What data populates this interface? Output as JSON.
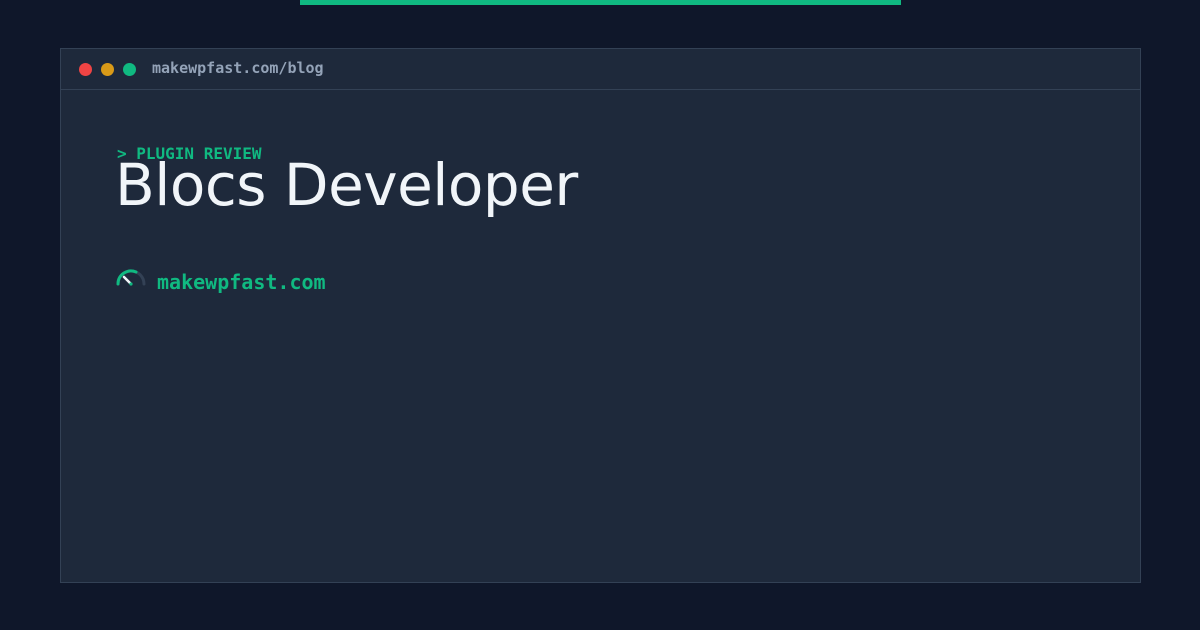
{
  "window": {
    "url": "makewpfast.com/blog"
  },
  "post": {
    "category": "> PLUGIN REVIEW",
    "title": "Blocs Developer"
  },
  "brand": {
    "name": "makewpfast.com",
    "icon": "speedometer-icon"
  },
  "colors": {
    "background": "#0f172a",
    "panel": "#1e293b",
    "accent": "#10b981",
    "title_text": "#f1f5f9",
    "url_text": "#94a3b8",
    "dot_red": "#ef4444",
    "dot_yellow": "#d99a18",
    "dot_green": "#10b981"
  }
}
